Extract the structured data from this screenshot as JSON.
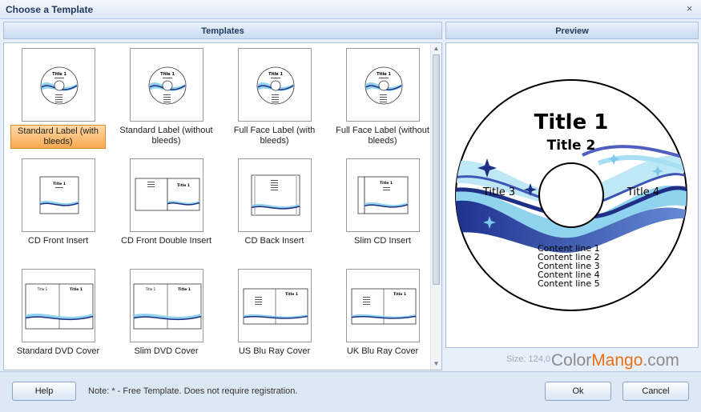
{
  "window": {
    "title": "Choose a Template",
    "close_glyph": "×"
  },
  "panels": {
    "templates_header": "Templates",
    "preview_header": "Preview"
  },
  "templates": [
    {
      "label": "Standard Label (with bleeds)",
      "kind": "disc",
      "selected": true
    },
    {
      "label": "Standard Label (without bleeds)",
      "kind": "disc",
      "selected": false
    },
    {
      "label": "Full Face Label (with bleeds)",
      "kind": "disc",
      "selected": false
    },
    {
      "label": "Full Face Label (without bleeds)",
      "kind": "disc",
      "selected": false
    },
    {
      "label": "CD Front Insert",
      "kind": "insert",
      "selected": false
    },
    {
      "label": "CD Front Double Insert",
      "kind": "double",
      "selected": false
    },
    {
      "label": "CD Back Insert",
      "kind": "back",
      "selected": false
    },
    {
      "label": "Slim CD Insert",
      "kind": "slim",
      "selected": false
    },
    {
      "label": "Standard DVD Cover",
      "kind": "dvd",
      "selected": false
    },
    {
      "label": "Slim DVD Cover",
      "kind": "dvd",
      "selected": false
    },
    {
      "label": "US Blu Ray Cover",
      "kind": "bluray",
      "selected": false
    },
    {
      "label": "UK Blu Ray Cover",
      "kind": "bluray",
      "selected": false
    }
  ],
  "preview": {
    "title1": "Title 1",
    "title2": "Title 2",
    "title3": "Title 3",
    "title4": "Title 4",
    "content_lines": [
      "Content line 1",
      "Content line 2",
      "Content line 3",
      "Content line 4",
      "Content line 5"
    ]
  },
  "size_text": "Size: 124,0",
  "watermark": {
    "part1": "Color",
    "part2": "Mango",
    "part3": ".com"
  },
  "footer": {
    "help_label": "Help",
    "note": "Note: * - Free Template. Does not require registration.",
    "ok_label": "Ok",
    "cancel_label": "Cancel"
  },
  "colors": {
    "accent_blue": "#2b3f9c",
    "wave_light": "#8fd3ee",
    "selection": "#f7a94f"
  },
  "icons": {
    "close": "close-icon",
    "scroll_up": "scroll-up-icon",
    "scroll_down": "scroll-down-icon"
  }
}
